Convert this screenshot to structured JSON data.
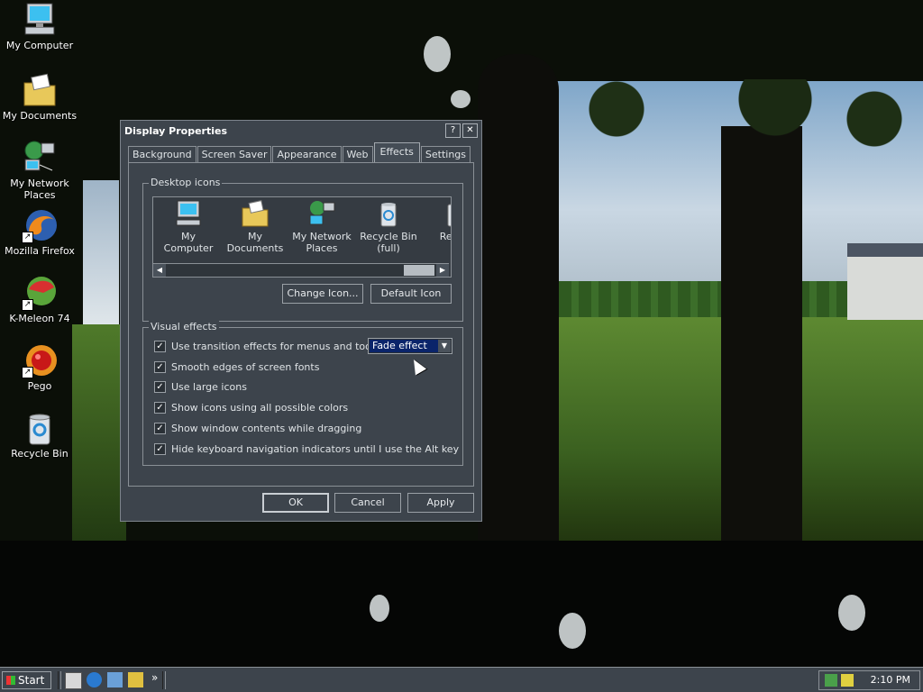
{
  "desktop": {
    "icons": [
      {
        "label": "My Computer",
        "icon": "my-computer-icon"
      },
      {
        "label": "My Documents",
        "icon": "my-documents-icon"
      },
      {
        "label": "My Network Places",
        "icon": "network-places-icon"
      },
      {
        "label": "Mozilla Firefox",
        "icon": "firefox-icon"
      },
      {
        "label": "K-Meleon 74",
        "icon": "kmeleon-icon"
      },
      {
        "label": "Pego",
        "icon": "pego-icon"
      },
      {
        "label": "Recycle Bin",
        "icon": "recycle-bin-icon"
      }
    ]
  },
  "dialog": {
    "title": "Display Properties",
    "help_glyph": "?",
    "close_glyph": "✕",
    "tabs": [
      "Background",
      "Screen Saver",
      "Appearance",
      "Web",
      "Effects",
      "Settings"
    ],
    "active_tab": "Effects",
    "desktop_icons": {
      "group_title": "Desktop icons",
      "items": [
        "My Computer",
        "My Documents",
        "My Network Places",
        "Recycle Bin (full)",
        "Rec (e"
      ],
      "change_icon_label": "Change Icon...",
      "default_icon_label": "Default Icon"
    },
    "visual_effects": {
      "group_title": "Visual effects",
      "options": [
        {
          "label": "Use transition effects for menus and tooltips",
          "checked": true
        },
        {
          "label": "Smooth edges of screen fonts",
          "checked": true
        },
        {
          "label": "Use large icons",
          "checked": true
        },
        {
          "label": "Show icons using all possible colors",
          "checked": true
        },
        {
          "label": "Show window contents while dragging",
          "checked": true
        },
        {
          "label": "Hide keyboard navigation indicators until I use the Alt key",
          "checked": true
        }
      ],
      "transition_select_value": "Fade effect"
    },
    "buttons": {
      "ok": "OK",
      "cancel": "Cancel",
      "apply": "Apply"
    }
  },
  "taskbar": {
    "start_label": "Start",
    "chevron": "»",
    "clock": "2:10 PM"
  },
  "colors": {
    "dialog_bg": "#3d444c",
    "selection": "#0a246a"
  }
}
